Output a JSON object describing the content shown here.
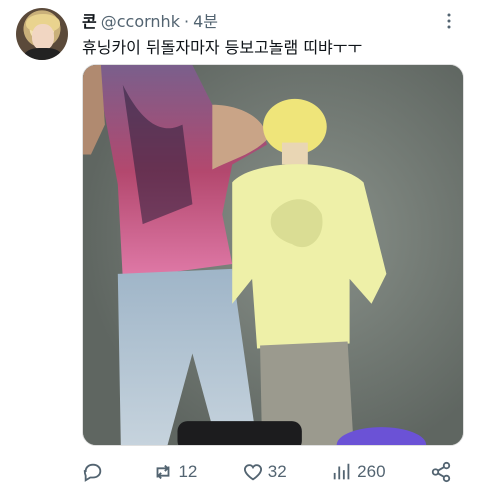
{
  "tweet": {
    "display_name": "콘",
    "handle": "@ccornhk",
    "separator": "·",
    "time": "4분",
    "text": "휴닝카이 뒤돌자마자 등보고놀램 띠뱌ㅜㅜ"
  },
  "actions": {
    "reply_count": "",
    "retweet_count": "12",
    "like_count": "32",
    "views_count": "260"
  },
  "icons": {
    "more": "more-dots-icon",
    "reply": "reply-icon",
    "retweet": "retweet-icon",
    "like": "heart-icon",
    "views": "views-chart-icon",
    "share": "share-icon"
  },
  "colors": {
    "text_primary": "#0f1419",
    "text_secondary": "#536471"
  }
}
